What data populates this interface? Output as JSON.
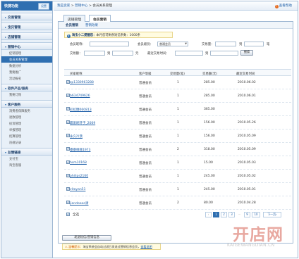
{
  "sidebar": {
    "title": "快捷功能",
    "settings_label": "设置",
    "sections": [
      {
        "label": "交易管理"
      },
      {
        "label": "宝贝管理"
      },
      {
        "label": "店铺管理"
      },
      {
        "label": "营销中心",
        "items": [
          "促销管理",
          "会员关系管理",
          "数据分析",
          "我要推广",
          "活动报名"
        ]
      },
      {
        "label": "软件产品/服务",
        "items": [
          "我要订购"
        ]
      },
      {
        "label": "客户服务",
        "items": [
          "消费者保障服务",
          "退款管理",
          "投诉管理",
          "举报管理",
          "结算管理",
          "违规记录"
        ]
      },
      {
        "label": "友情链接",
        "items": [
          "支付宝",
          "淘宝客服"
        ]
      }
    ]
  },
  "topbar": {
    "crumb_home": "我是卖家",
    "crumb_mid": "营销中心",
    "crumb_current": "会员关系管理",
    "help_label": "查看帮助"
  },
  "main_tabs": [
    "店铺管理",
    "会员营销"
  ],
  "sub_tabs": [
    "会员营销",
    "营销效果"
  ],
  "notice": {
    "prefix": "淘宝小二提醒您：",
    "text": "本月您可剩余短信条数：1000条"
  },
  "filters": {
    "nick_label": "会员昵称：",
    "level_label": "会员级别：",
    "level_value": "普通会员",
    "count_label": "交易量：",
    "to_label": "到",
    "unit_label": "笔",
    "amount_label": "交易额：",
    "yuan_label": "元",
    "last_label": "最近交易时间：",
    "search_btn": "搜索"
  },
  "table": {
    "headers": [
      "买家昵称",
      "客户等级",
      "交易量(笔)",
      "交易额(元)",
      "最近交易时间"
    ],
    "rows": [
      {
        "nick": "zp1330963288",
        "level": "普通会员",
        "count": "1",
        "amount": "285.00",
        "date": "2010.06.02"
      },
      {
        "nick": "b634749626",
        "level": "普通会员",
        "count": "1",
        "amount": "285.00",
        "date": "2010.06.01"
      },
      {
        "nick": "彩虹糖060813",
        "level": "普通会员",
        "count": "1",
        "amount": "365.00",
        "date": ""
      },
      {
        "nick": "最爱刷牙子_2009",
        "level": "普通会员",
        "count": "1",
        "amount": "156.00",
        "date": "2010.05.26"
      },
      {
        "nick": "永久冷漠",
        "level": "普通会员",
        "count": "1",
        "amount": "156.00",
        "date": "2010.05.09"
      },
      {
        "nick": "睿睿缘缘1973",
        "level": "普通会员",
        "count": "2",
        "amount": "318.00",
        "date": "2010.05.09"
      },
      {
        "nick": "hsm10168",
        "level": "普通会员",
        "count": "1",
        "amount": "15.00",
        "date": "2010.05.03"
      },
      {
        "nick": "philips2160",
        "level": "普通会员",
        "count": "1",
        "amount": "245.00",
        "date": "2010.05.02"
      },
      {
        "nick": "vitayan51",
        "level": "普通会员",
        "count": "1",
        "amount": "245.00",
        "date": "2010.05.01"
      },
      {
        "nick": "jiandoooe清",
        "level": "普通会员",
        "count": "2",
        "amount": "80.00",
        "date": "2010.04.28"
      }
    ],
    "select_all": "全选"
  },
  "pager": {
    "prev": "‹",
    "pages": [
      "1",
      "2",
      "3"
    ],
    "ellipsis": "…",
    "tail_pages": [
      "9",
      "10"
    ],
    "next": "下一页›"
  },
  "send_button": "发送短信/营销信息",
  "tip": {
    "prefix": "温馨提示：",
    "text": "淘宝系统会自动过滤已发送过营销信息会员，",
    "link": "查看说明"
  },
  "watermark": {
    "logo": "开店网",
    "url": "KAIGEWANGDIAN.CN"
  },
  "colors": {
    "brand_blue": "#2f6fb1",
    "link_blue": "#1f5fa8",
    "notice_bg": "#fffbe0"
  }
}
